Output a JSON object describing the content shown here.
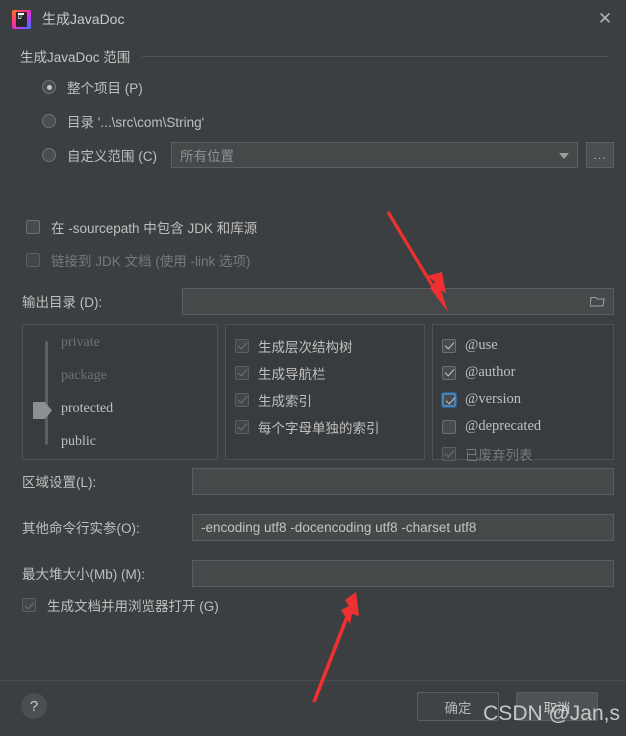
{
  "window": {
    "title": "生成JavaDoc",
    "app_icon": "intellij-idea-icon",
    "close_label": "✕"
  },
  "scope_group": {
    "title": "生成JavaDoc 范围",
    "radios": [
      {
        "label": "整个项目 (P)",
        "checked": true
      },
      {
        "label": "目录 '...\\src\\com\\String'",
        "checked": false
      },
      {
        "label": "自定义范围 (C)",
        "checked": false
      }
    ],
    "custom_scope_combo": {
      "value": "所有位置",
      "browse_label": "..."
    }
  },
  "options": {
    "include_jdk": {
      "label": "在 -sourcepath 中包含 JDK 和库源",
      "checked": false
    },
    "link_jdk_docs": {
      "label": "链接到 JDK 文档 (使用 -link 选项)",
      "checked": false,
      "disabled": true
    },
    "output_dir": {
      "label": "输出目录 (D):",
      "value": "",
      "icon": "folder-icon"
    }
  },
  "visibility_panel": {
    "items": [
      {
        "label": "private",
        "dim": true
      },
      {
        "label": "package",
        "dim": true
      },
      {
        "label": "protected",
        "dim": false
      },
      {
        "label": "public",
        "dim": false
      }
    ],
    "selected": "protected"
  },
  "generate_panel": {
    "items": [
      {
        "label": "生成层次结构树",
        "checked": true
      },
      {
        "label": "生成导航栏",
        "checked": true
      },
      {
        "label": "生成索引",
        "checked": true
      },
      {
        "label": "每个字母单独的索引",
        "checked": true
      }
    ]
  },
  "tags_panel": {
    "items": [
      {
        "label": "@use",
        "checked": true,
        "focused": false,
        "disabled": false
      },
      {
        "label": "@author",
        "checked": true,
        "focused": false,
        "disabled": false
      },
      {
        "label": "@version",
        "checked": true,
        "focused": true,
        "disabled": false
      },
      {
        "label": "@deprecated",
        "checked": false,
        "focused": false,
        "disabled": false
      },
      {
        "label": "已废弃列表",
        "checked": true,
        "focused": false,
        "disabled": true
      }
    ]
  },
  "fields": {
    "locale": {
      "label": "区域设置(L):",
      "value": ""
    },
    "other_args": {
      "label": "其他命令行实参(O):",
      "value": "-encoding utf8 -docencoding utf8 -charset utf8"
    },
    "max_heap": {
      "label": "最大堆大小(Mb) (M):",
      "value": ""
    }
  },
  "open_in_browser": {
    "label": "生成文档并用浏览器打开 (G)",
    "checked": true
  },
  "footer": {
    "help_label": "?",
    "ok_label": "确定",
    "cancel_label": "取消"
  },
  "watermark": {
    "text": "CSDN @Jan,s"
  },
  "colors": {
    "background": "#3c3f41",
    "field_bg": "#45494a",
    "panel_bg": "#393c3e",
    "border": "#5a5e60",
    "text": "#bfbfbf",
    "text_dim": "#76797b",
    "focus_blue": "#4a82b8",
    "arrow_red": "#f03030"
  }
}
